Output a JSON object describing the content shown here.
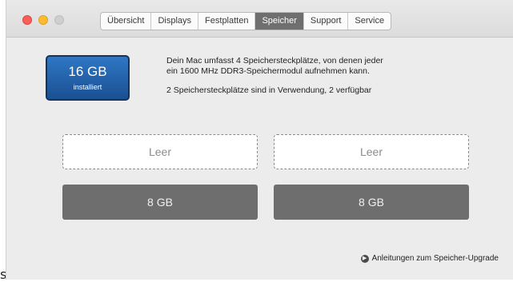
{
  "tabs": [
    "Übersicht",
    "Displays",
    "Festplatten",
    "Speicher",
    "Support",
    "Service"
  ],
  "active_tab_index": 3,
  "memory": {
    "installed_size": "16 GB",
    "installed_label": "installiert"
  },
  "info": {
    "line1": "Dein Mac umfasst 4 Speichersteckplätze, von denen jeder",
    "line2": "ein 1600 MHz DDR3-Speichermodul aufnehmen kann.",
    "line3": "2 Speichersteckplätze sind in Verwendung, 2 verfügbar"
  },
  "slots": {
    "empty_1": "Leer",
    "empty_2": "Leer",
    "full_1": "8 GB",
    "full_2": "8 GB"
  },
  "upgrade_link": "Anleitungen zum Speicher-Upgrade",
  "stray_text": "s",
  "colors": {
    "badge": "#2f77c4",
    "active_tab": "#6f6f6f",
    "filled_slot": "#6e6e6e"
  }
}
